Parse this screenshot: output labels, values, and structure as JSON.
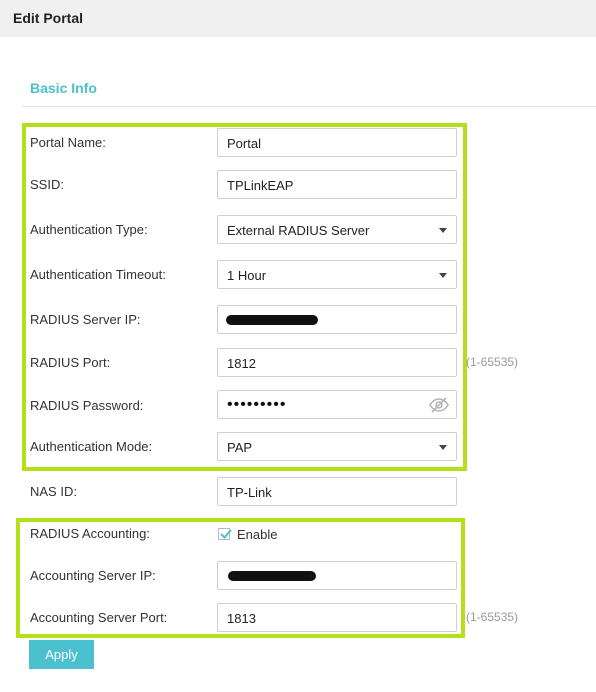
{
  "header": {
    "title": "Edit Portal"
  },
  "section": {
    "title": "Basic Info"
  },
  "form": {
    "portal_name": {
      "label": "Portal Name:",
      "value": "Portal"
    },
    "ssid": {
      "label": "SSID:",
      "value": "TPLinkEAP"
    },
    "auth_type": {
      "label": "Authentication Type:",
      "value": "External RADIUS Server"
    },
    "auth_timeout": {
      "label": "Authentication Timeout:",
      "value": "1 Hour"
    },
    "radius_ip": {
      "label": "RADIUS Server IP:"
    },
    "radius_port": {
      "label": "RADIUS Port:",
      "value": "1812",
      "hint": "(1-65535)"
    },
    "radius_password": {
      "label": "RADIUS Password:",
      "value": "•••••••••"
    },
    "auth_mode": {
      "label": "Authentication Mode:",
      "value": "PAP"
    },
    "nas_id": {
      "label": "NAS ID:",
      "value": "TP-Link"
    },
    "radius_accounting": {
      "label": "RADIUS Accounting:",
      "checkbox_label": "Enable",
      "checked": true
    },
    "acct_ip": {
      "label": "Accounting Server IP:"
    },
    "acct_port": {
      "label": "Accounting Server Port:",
      "value": "1813",
      "hint": "(1-65535)"
    }
  },
  "buttons": {
    "apply": "Apply"
  },
  "colors": {
    "accent": "#4bc1d0",
    "highlight": "#b4e018",
    "header_bg": "#f0f0f0"
  },
  "icons": {
    "password_toggle": "eye-slash-icon",
    "checkbox": "checkmark-icon",
    "dropdown": "caret-down-icon"
  }
}
